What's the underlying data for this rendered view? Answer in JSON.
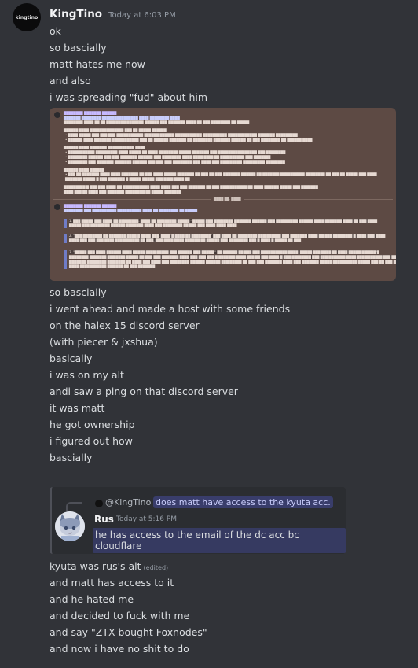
{
  "message": {
    "avatar_text": "kingtino",
    "username": "KingTino",
    "timestamp": "Today at 6:03 PM",
    "lines_top": [
      "ok",
      "so bascially",
      "matt hates me now",
      "and also",
      "i was spreading \"fud\" about him"
    ],
    "lines_middle": [
      "so bascially",
      "i went ahead and made a host with some friends",
      "on the halex 15 discord server",
      "(with piecer & jxshua)",
      "basically",
      "i was on my alt",
      "andi  saw a ping on that discord server",
      "it was matt",
      "he got ownership",
      "i figured out how",
      "bascially"
    ],
    "lines_bottom": [
      {
        "text": "kyuta was rus's alt",
        "edited": "(edited)"
      },
      {
        "text": "and matt has access to it",
        "edited": ""
      },
      {
        "text": "and he hated me",
        "edited": ""
      },
      {
        "text": "and decided to fuck with me",
        "edited": ""
      },
      {
        "text": "and say \"ZTX bought Foxnodes\"",
        "edited": ""
      },
      {
        "text": "and now i have no shit to do",
        "edited": ""
      }
    ]
  },
  "reply_card": {
    "replied_name": "@KingTino",
    "replied_text": "does matt have access to the kyuta acc.",
    "author": "Rus",
    "time": "Today at 5:16 PM",
    "text": "he has access to the email of the dc acc bc cloudflare"
  },
  "colors": {
    "background": "#313338",
    "embed_bg": "#5d4a44",
    "mention_bg": "#3c4270",
    "username": "#f2f3f5"
  }
}
